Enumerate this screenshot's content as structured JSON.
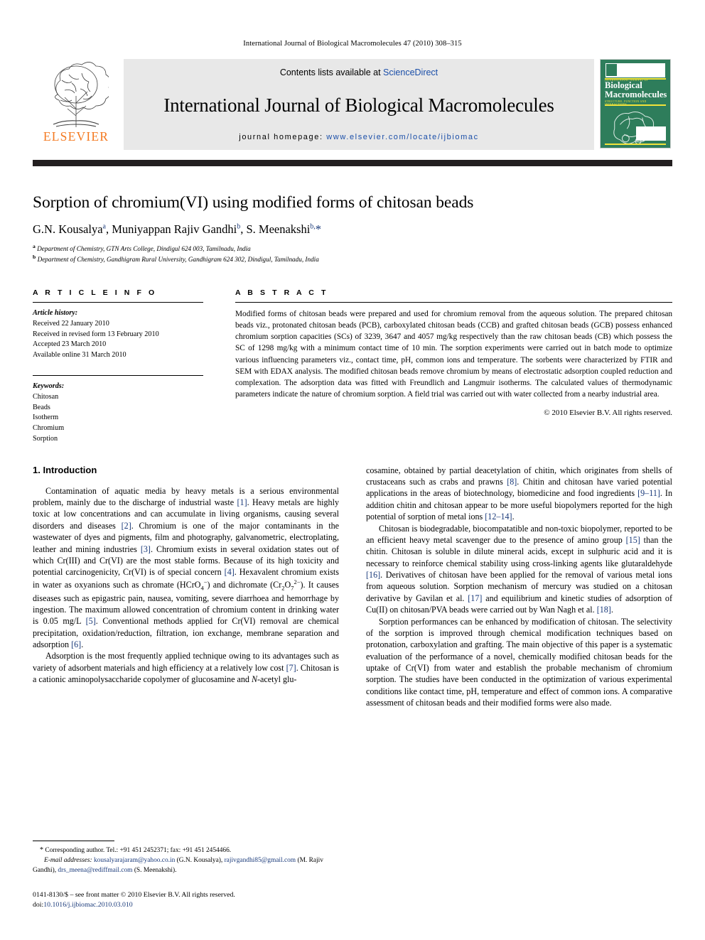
{
  "running_head": "International Journal of Biological Macromolecules 47 (2010) 308–315",
  "masthead": {
    "publisher_name": "ELSEVIER",
    "contents_prefix": "Contents lists available at",
    "contents_link": "ScienceDirect",
    "journal_title": "International Journal of Biological Macromolecules",
    "homepage_prefix": "journal homepage:",
    "homepage_url": "www.elsevier.com/locate/ijbiomac",
    "cover": {
      "line1": "Biological",
      "line2": "Macromolecules",
      "top_caption": "INTERNATIONAL JOURNAL OF",
      "sub_caption": "STRUCTURE, FUNCTION AND INTERACTIONS"
    },
    "colors": {
      "link": "#1a4ea8",
      "elsevier_orange": "#F47920",
      "band_gray": "#e8e8e8",
      "cover_green": "#2e7d5b",
      "rule_dark": "#231f20"
    }
  },
  "article": {
    "title": "Sorption of chromium(VI) using modified forms of chitosan beads",
    "authors_html": "G.N. Kousalya<sup>a</sup>, Muniyappan Rajiv Gandhi<sup>b</sup>, S. Meenakshi<sup>b,</sup><span class=\"star\">*</span>",
    "affiliation_a": "Department of Chemistry, GTN Arts College, Dindigul 624 003, Tamilnadu, India",
    "affiliation_b": "Department of Chemistry, Gandhigram Rural University, Gandhigram 624 302, Dindigul, Tamilnadu, India"
  },
  "article_info": {
    "heading": "A R T I C L E    I N F O",
    "history_label": "Article history:",
    "history": [
      "Received 22 January 2010",
      "Received in revised form 13 February 2010",
      "Accepted 23 March 2010",
      "Available online 31 March 2010"
    ],
    "keywords_label": "Keywords:",
    "keywords": [
      "Chitosan",
      "Beads",
      "Isotherm",
      "Chromium",
      "Sorption"
    ]
  },
  "abstract": {
    "heading": "A B S T R A C T",
    "text": "Modified forms of chitosan beads were prepared and used for chromium removal from the aqueous solution. The prepared chitosan beads viz., protonated chitosan beads (PCB), carboxylated chitosan beads (CCB) and grafted chitosan beads (GCB) possess enhanced chromium sorption capacities (SCs) of 3239, 3647 and 4057 mg/kg respectively than the raw chitosan beads (CB) which possess the SC of 1298 mg/kg with a minimum contact time of 10 min. The sorption experiments were carried out in batch mode to optimize various influencing parameters viz., contact time, pH, common ions and temperature. The sorbents were characterized by FTIR and SEM with EDAX analysis. The modified chitosan beads remove chromium by means of electrostatic adsorption coupled reduction and complexation. The adsorption data was fitted with Freundlich and Langmuir isotherms. The calculated values of thermodynamic parameters indicate the nature of chromium sorption. A field trial was carried out with water collected from a nearby industrial area.",
    "copyright": "© 2010 Elsevier B.V. All rights reserved."
  },
  "introduction": {
    "heading": "1. Introduction",
    "left_paragraphs": [
      "Contamination of aquatic media by heavy metals is a serious environmental problem, mainly due to the discharge of industrial waste <span class=\"ref\">[1]</span>. Heavy metals are highly toxic at low concentrations and can accumulate in living organisms, causing several disorders and diseases <span class=\"ref\">[2]</span>. Chromium is one of the major contaminants in the wastewater of dyes and pigments, film and photography, galvanometric, electroplating, leather and mining industries <span class=\"ref\">[3]</span>. Chromium exists in several oxidation states out of which Cr(III) and Cr(VI) are the most stable forms. Because of its high toxicity and potential carcinogenicity, Cr(VI) is of special concern <span class=\"ref\">[4]</span>. Hexavalent chromium exists in water as oxyanions such as chromate (HCrO<sub>4</sub><sup>−</sup>) and dichromate (Cr<sub>2</sub>O<sub>7</sub><sup>2−</sup>). It causes diseases such as epigastric pain, nausea, vomiting, severe diarrhoea and hemorrhage by ingestion. The maximum allowed concentration of chromium content in drinking water is 0.05 mg/L <span class=\"ref\">[5]</span>. Conventional methods applied for Cr(VI) removal are chemical precipitation, oxidation/reduction, filtration, ion exchange, membrane separation and adsorption <span class=\"ref\">[6]</span>.",
      "Adsorption is the most frequently applied technique owing to its advantages such as variety of adsorbent materials and high efficiency at a relatively low cost <span class=\"ref\">[7]</span>. Chitosan is a cationic aminopolysaccharide copolymer of glucosamine and <i>N</i>-acetyl glu-"
    ],
    "right_paragraphs": [
      "cosamine, obtained by partial deacetylation of chitin, which originates from shells of crustaceans such as crabs and prawns <span class=\"ref\">[8]</span>. Chitin and chitosan have varied potential applications in the areas of biotechnology, biomedicine and food ingredients <span class=\"ref\">[9–11]</span>. In addition chitin and chitosan appear to be more useful biopolymers reported for the high potential of sorption of metal ions <span class=\"ref\">[12–14]</span>.",
      "Chitosan is biodegradable, biocompatatible and non-toxic biopolymer, reported to be an efficient heavy metal scavenger due to the presence of amino group <span class=\"ref\">[15]</span> than the chitin. Chitosan is soluble in dilute mineral acids, except in sulphuric acid and it is necessary to reinforce chemical stability using cross-linking agents like glutaraldehyde <span class=\"ref\">[16]</span>. Derivatives of chitosan have been applied for the removal of various metal ions from aqueous solution. Sorption mechanism of mercury was studied on a chitosan derivative by Gavilan et al. <span class=\"ref\">[17]</span> and equilibrium and kinetic studies of adsorption of Cu(II) on chitosan/PVA beads were carried out by Wan Nagh et al. <span class=\"ref\">[18]</span>.",
      "Sorption performances can be enhanced by modification of chitosan. The selectivity of the sorption is improved through chemical modification techniques based on protonation, carboxylation and grafting. The main objective of this paper is a systematic evaluation of the performance of a novel, chemically modified chitosan beads for the uptake of Cr(VI) from water and establish the probable mechanism of chromium sorption. The studies have been conducted in the optimization of various experimental conditions like contact time, pH, temperature and effect of common ions. A comparative assessment of chitosan beads and their modified forms were also made."
    ]
  },
  "footnotes": {
    "corresponding_html": "<span style=\"font-size:10px;\">*</span> Corresponding author. Tel.: +91 451 2452371; fax: +91 451 2454466.",
    "emails_html": "<span class=\"italic\">E-mail addresses:</span> <span class=\"mail\">kousalyarajaram@yahoo.co.in</span> (G.N. Kousalya), <span class=\"mail\">rajivgandhi85@gmail.com</span> (M. Rajiv Gandhi), <span class=\"mail\">drs_meena@rediffmail.com</span> (S. Meenakshi).",
    "issn_line": "0141-8130/$ – see front matter © 2010 Elsevier B.V. All rights reserved.",
    "doi_label": "doi:",
    "doi_value": "10.1016/j.ijbiomac.2010.03.010"
  }
}
